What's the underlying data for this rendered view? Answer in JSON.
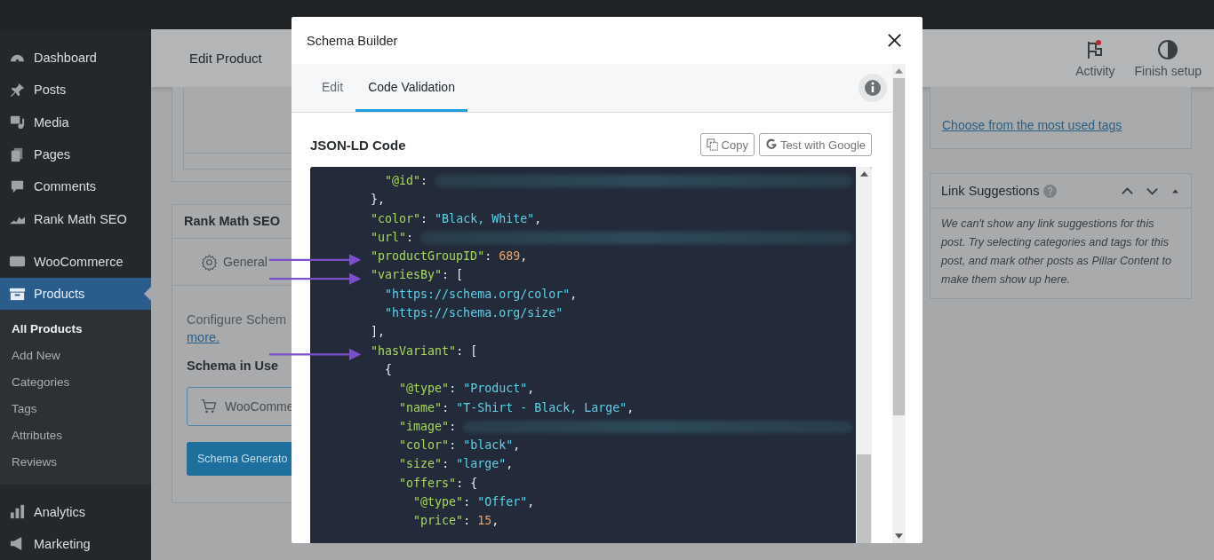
{
  "sidebar": {
    "items": [
      {
        "label": "Dashboard",
        "selected": false
      },
      {
        "label": "Posts",
        "selected": false
      },
      {
        "label": "Media",
        "selected": false
      },
      {
        "label": "Pages",
        "selected": false
      },
      {
        "label": "Comments",
        "selected": false
      },
      {
        "label": "Rank Math SEO",
        "selected": false
      },
      {
        "label": "WooCommerce",
        "selected": false
      },
      {
        "label": "Products",
        "selected": true,
        "children": [
          {
            "label": "All Products",
            "selected": true
          },
          {
            "label": "Add New",
            "selected": false
          },
          {
            "label": "Categories",
            "selected": false
          },
          {
            "label": "Tags",
            "selected": false
          },
          {
            "label": "Attributes",
            "selected": false
          },
          {
            "label": "Reviews",
            "selected": false
          }
        ]
      },
      {
        "label": "Analytics",
        "selected": false
      },
      {
        "label": "Marketing",
        "selected": false
      }
    ]
  },
  "header": {
    "title": "Edit Product",
    "actions": [
      {
        "label": "Activity",
        "badge": true
      },
      {
        "label": "Finish setup",
        "badge": false
      }
    ]
  },
  "rank_math_panel": {
    "title": "Rank Math SEO",
    "tab": "General",
    "description": "Configure Schem",
    "link": "more.",
    "schema_heading": "Schema in Use",
    "schema_item": "WooComme",
    "button": "Schema Generato"
  },
  "tags_panel": {
    "link": "Choose from the most used tags"
  },
  "link_suggestions": {
    "title": "Link Suggestions",
    "text": "We can't show any link suggestions for this post. Try selecting categories and tags for this post, and mark other posts as Pillar Content to make them show up here."
  },
  "modal": {
    "title": "Schema Builder",
    "tabs": [
      {
        "label": "Edit",
        "selected": false
      },
      {
        "label": "Code Validation",
        "selected": true
      }
    ],
    "heading": "JSON-LD Code",
    "buttons": [
      {
        "label": "Copy",
        "kind": "copy"
      },
      {
        "label": "Test with Google",
        "kind": "google"
      }
    ],
    "code_lines": [
      [
        {
          "kind": "key",
          "text": "          \"@id\""
        },
        {
          "kind": "punct",
          "text": ": "
        },
        {
          "kind": "redacted"
        }
      ],
      [
        {
          "kind": "punct",
          "text": "        },"
        }
      ],
      [
        {
          "kind": "key",
          "text": "        \"color\""
        },
        {
          "kind": "punct",
          "text": ": "
        },
        {
          "kind": "string",
          "text": "\"Black, White\""
        },
        {
          "kind": "punct",
          "text": ","
        }
      ],
      [
        {
          "kind": "key",
          "text": "        \"url\""
        },
        {
          "kind": "punct",
          "text": ": "
        },
        {
          "kind": "redacted"
        }
      ],
      [
        {
          "kind": "key",
          "text": "        \"productGroupID\""
        },
        {
          "kind": "punct",
          "text": ": "
        },
        {
          "kind": "number",
          "text": "689"
        },
        {
          "kind": "punct",
          "text": ","
        }
      ],
      [
        {
          "kind": "key",
          "text": "        \"variesBy\""
        },
        {
          "kind": "punct",
          "text": ": ["
        }
      ],
      [
        {
          "kind": "string",
          "text": "          \"https://schema.org/color\""
        },
        {
          "kind": "punct",
          "text": ","
        }
      ],
      [
        {
          "kind": "string",
          "text": "          \"https://schema.org/size\""
        }
      ],
      [
        {
          "kind": "punct",
          "text": "        ],"
        }
      ],
      [
        {
          "kind": "key",
          "text": "        \"hasVariant\""
        },
        {
          "kind": "punct",
          "text": ": ["
        }
      ],
      [
        {
          "kind": "punct",
          "text": "          {"
        }
      ],
      [
        {
          "kind": "key",
          "text": "            \"@type\""
        },
        {
          "kind": "punct",
          "text": ": "
        },
        {
          "kind": "string",
          "text": "\"Product\""
        },
        {
          "kind": "punct",
          "text": ","
        }
      ],
      [
        {
          "kind": "key",
          "text": "            \"name\""
        },
        {
          "kind": "punct",
          "text": ": "
        },
        {
          "kind": "string",
          "text": "\"T-Shirt - Black, Large\""
        },
        {
          "kind": "punct",
          "text": ","
        }
      ],
      [
        {
          "kind": "key",
          "text": "            \"image\""
        },
        {
          "kind": "punct",
          "text": ": "
        },
        {
          "kind": "redacted"
        }
      ],
      [
        {
          "kind": "key",
          "text": "            \"color\""
        },
        {
          "kind": "punct",
          "text": ": "
        },
        {
          "kind": "string",
          "text": "\"black\""
        },
        {
          "kind": "punct",
          "text": ","
        }
      ],
      [
        {
          "kind": "key",
          "text": "            \"size\""
        },
        {
          "kind": "punct",
          "text": ": "
        },
        {
          "kind": "string",
          "text": "\"large\""
        },
        {
          "kind": "punct",
          "text": ","
        }
      ],
      [
        {
          "kind": "key",
          "text": "            \"offers\""
        },
        {
          "kind": "punct",
          "text": ": {"
        }
      ],
      [
        {
          "kind": "key",
          "text": "              \"@type\""
        },
        {
          "kind": "punct",
          "text": ": "
        },
        {
          "kind": "string",
          "text": "\"Offer\""
        },
        {
          "kind": "punct",
          "text": ","
        }
      ],
      [
        {
          "kind": "key",
          "text": "              \"price\""
        },
        {
          "kind": "punct",
          "text": ": "
        },
        {
          "kind": "number",
          "text": "15"
        },
        {
          "kind": "punct",
          "text": ","
        }
      ]
    ]
  }
}
